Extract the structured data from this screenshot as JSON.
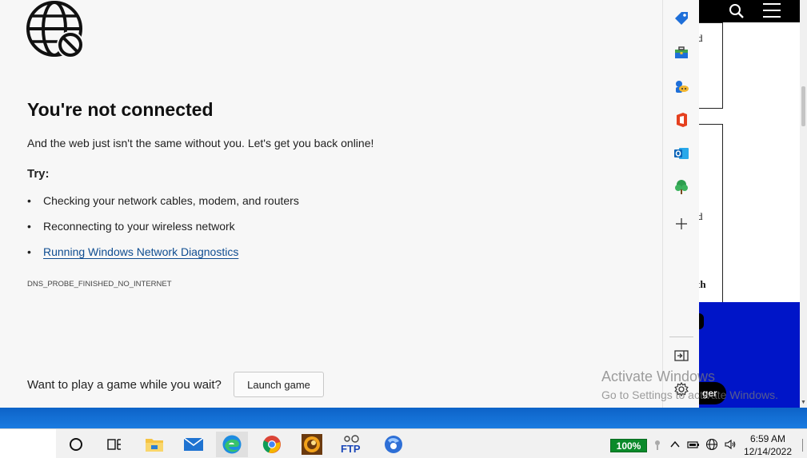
{
  "error_page": {
    "title": "You're not connected",
    "subtitle": "And the web just isn't the same without you. Let's get you back online!",
    "try_label": "Try:",
    "suggestions": [
      "Checking your network cables, modem, and routers",
      "Reconnecting to your wireless network",
      "Running Windows Network Diagnostics"
    ],
    "bullet": "•",
    "error_code": "DNS_PROBE_FINISHED_NO_INTERNET",
    "game_prompt": "Want to play a game while you wait?",
    "game_button": "Launch game"
  },
  "sidebar": {
    "icons": [
      "tag-icon",
      "toolbox-icon",
      "games-icon",
      "office-icon",
      "outlook-icon",
      "tree-icon",
      "add-icon",
      "hide-sidebar-icon",
      "settings-icon"
    ]
  },
  "background_page": {
    "fragments": [
      "d",
      "d",
      "th"
    ],
    "button_fragment": "ger"
  },
  "watermark": {
    "title": "Activate Windows",
    "subtitle": "Go to Settings to activate Windows."
  },
  "taskbar": {
    "apps": [
      "cortana-icon",
      "task-view-icon",
      "file-explorer-icon",
      "mail-icon",
      "edge-icon",
      "chrome-icon",
      "game-app-icon",
      "ftp-icon",
      "browser-app-icon"
    ],
    "active_app": "edge-icon",
    "battery": "100%",
    "time": "6:59 AM",
    "date": "12/14/2022"
  },
  "colors": {
    "link": "#0f4d91",
    "taskbar_strip": "#1a7be0",
    "battery": "#0a8a2a",
    "background_blue": "#0015c8"
  }
}
